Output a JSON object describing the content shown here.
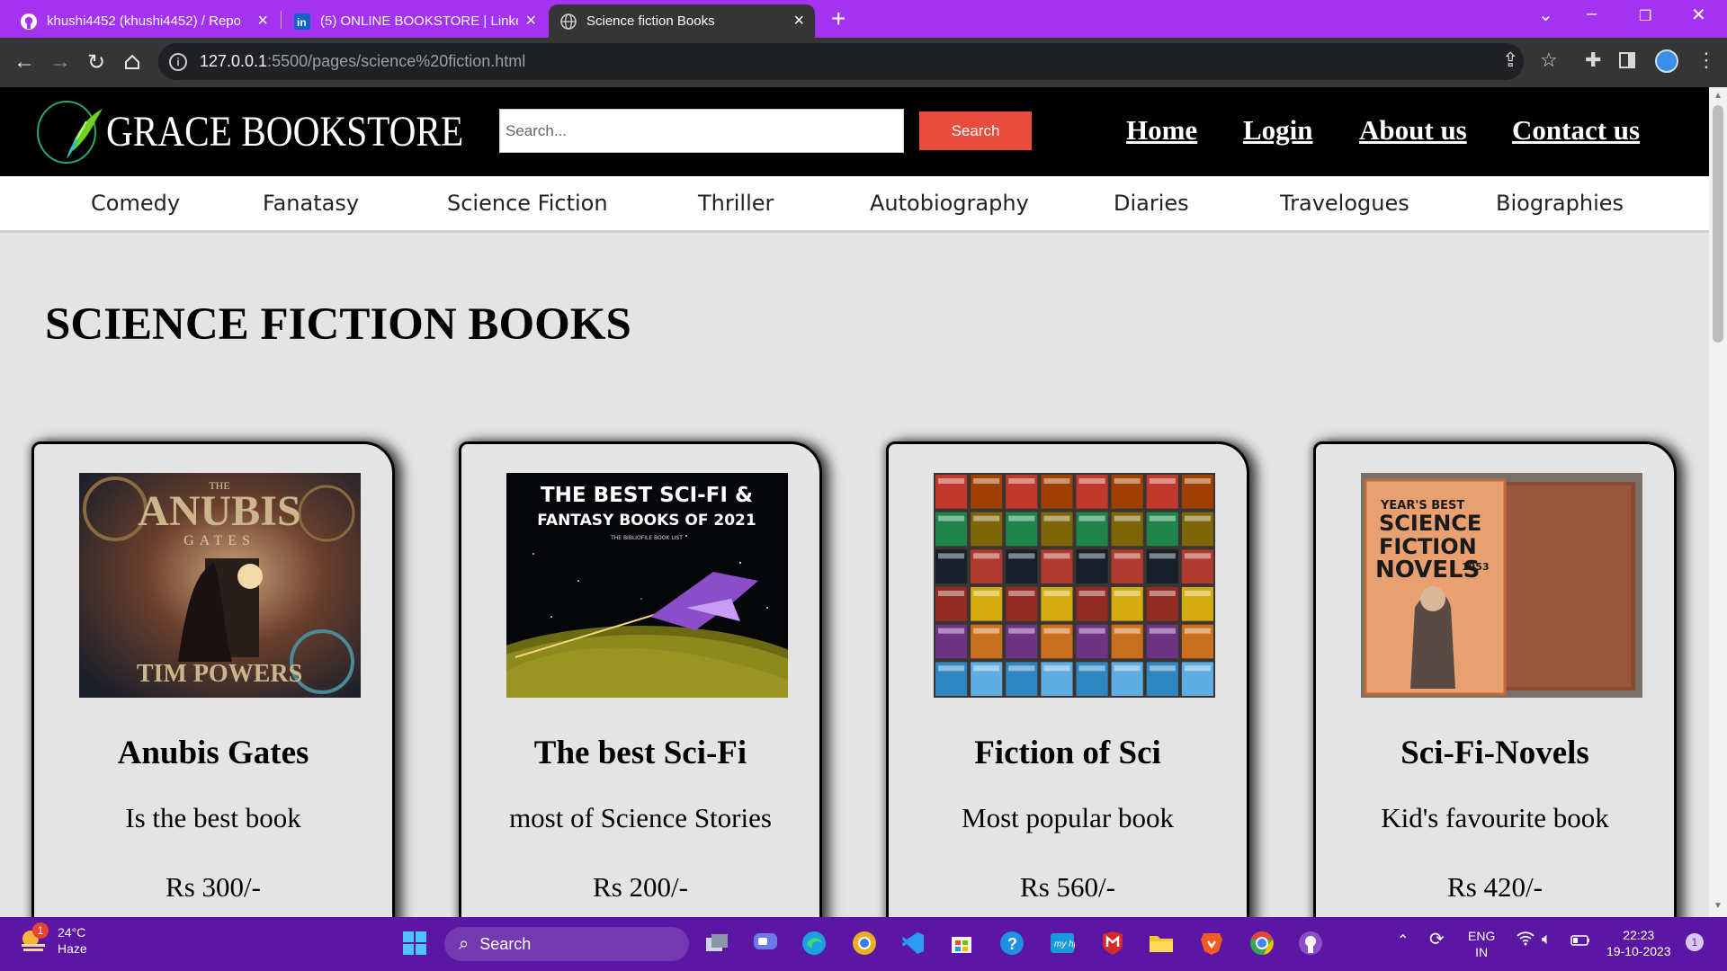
{
  "browser": {
    "tabs": [
      {
        "title": "khushi4452 (khushi4452) / Repo",
        "icon": "github-icon",
        "active": false
      },
      {
        "title": "(5) ONLINE BOOKSTORE | Linked",
        "icon": "linkedin-icon",
        "active": false
      },
      {
        "title": "Science fiction Books",
        "icon": "globe-icon",
        "active": true
      }
    ],
    "url_host": "127.0.0.1",
    "url_path": ":5500/pages/science%20fiction.html"
  },
  "site": {
    "brand": "GRACE BOOKSTORE",
    "search_placeholder": "Search...",
    "search_button": "Search",
    "nav": [
      "Home",
      "Login",
      "About us",
      "Contact us"
    ],
    "categories": [
      "Comedy",
      "Fanatasy",
      "Science Fiction",
      "Thriller",
      "Autobiography",
      "Diaries",
      "Travelogues",
      "Biographies"
    ]
  },
  "main": {
    "heading": "SCIENCE FICTION BOOKS",
    "books": [
      {
        "title": "Anubis Gates",
        "description": "Is the best book",
        "price": "Rs 300/-",
        "cover_text_top": "THE",
        "cover_title": "ANUBIS",
        "cover_sub": "GATES",
        "cover_author": "TIM POWERS"
      },
      {
        "title": "The best Sci-Fi",
        "description": "most of Science Stories",
        "price": "Rs 200/-",
        "cover_line1": "THE BEST SCI-FI &",
        "cover_line2": "FANTASY BOOKS OF 2021",
        "cover_line3": "THE BIBLIOFILE BOOK LIST"
      },
      {
        "title": "Fiction of Sci",
        "description": "Most popular book",
        "price": "Rs 560/-"
      },
      {
        "title": "Sci-Fi-Novels",
        "description": "Kid's favourite book",
        "price": "Rs 420/-",
        "cover_line1": "YEAR'S BEST",
        "cover_line2": "SCIENCE",
        "cover_line3": "FICTION",
        "cover_line4": "NOVELS",
        "cover_year": "1953"
      }
    ]
  },
  "taskbar": {
    "temperature": "24°C",
    "condition": "Haze",
    "weather_badge": "1",
    "search_label": "Search",
    "language": "ENG",
    "region": "IN",
    "time": "22:23",
    "date": "19-10-2023",
    "notification_count": "1"
  },
  "colors": {
    "tabstrip": "#a333f0",
    "toolbar": "#353535",
    "header": "#000000",
    "search_button": "#e84c3d",
    "page_bg": "#e4e4e4",
    "taskbar": "#5b17a3"
  }
}
